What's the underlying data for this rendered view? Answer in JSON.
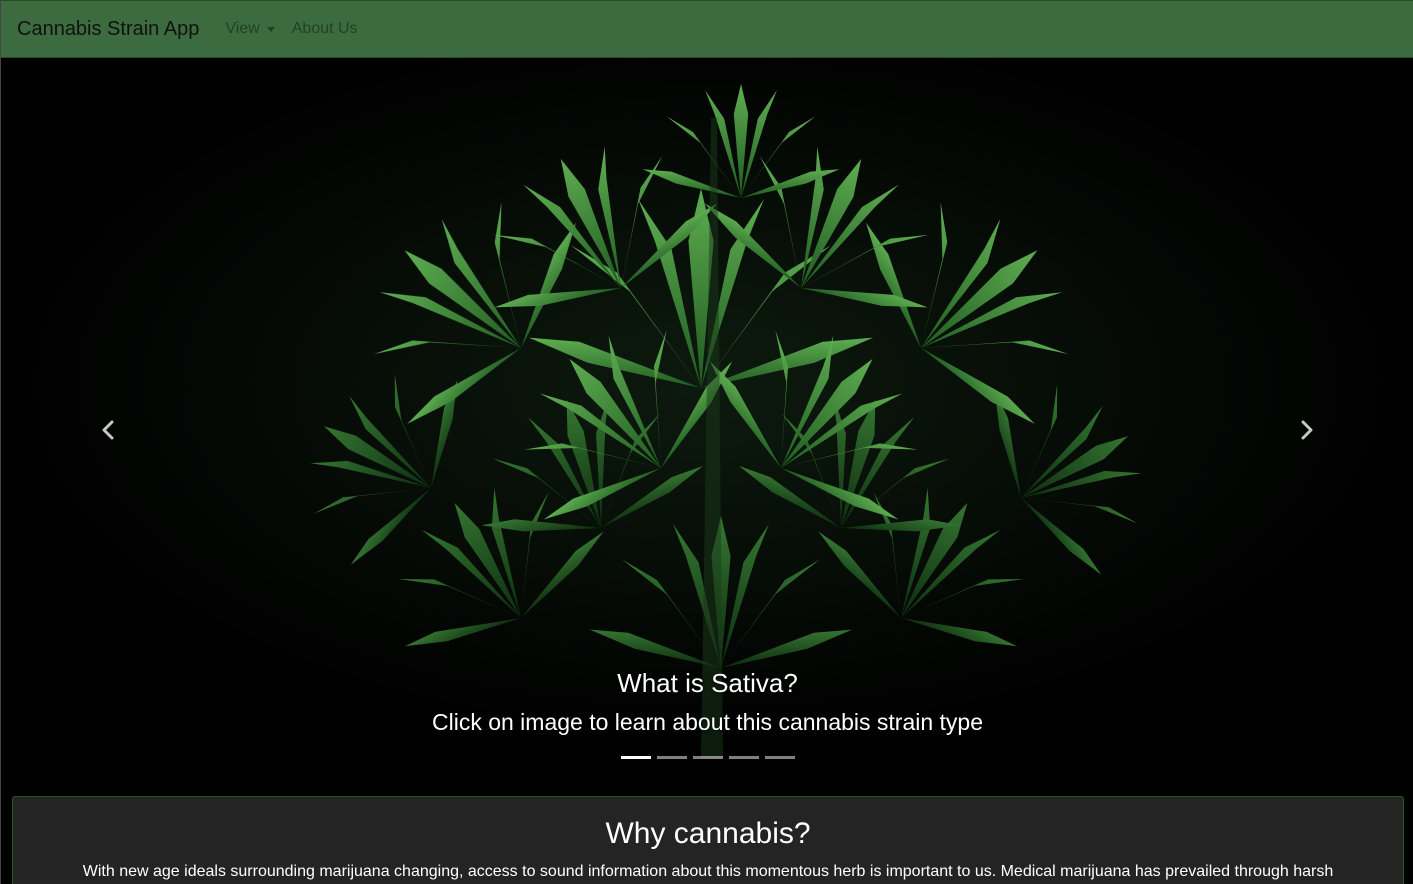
{
  "navbar": {
    "brand": "Cannabis Strain App",
    "items": [
      {
        "label": "View",
        "dropdown": true
      },
      {
        "label": "About Us",
        "dropdown": false
      }
    ],
    "background": "#3b6b3e"
  },
  "carousel": {
    "slide_title": "What is Sativa?",
    "slide_text": "Click on image to learn about this cannabis strain type",
    "prev_icon": "chevron-left-icon",
    "next_icon": "chevron-right-icon",
    "slide_count": 5,
    "active_index": 0
  },
  "info": {
    "title": "Why cannabis?",
    "body": "With new age ideals surrounding marijuana changing, access to sound information about this momentous herb is important to us. Medical marijuana has prevailed through harsh"
  }
}
